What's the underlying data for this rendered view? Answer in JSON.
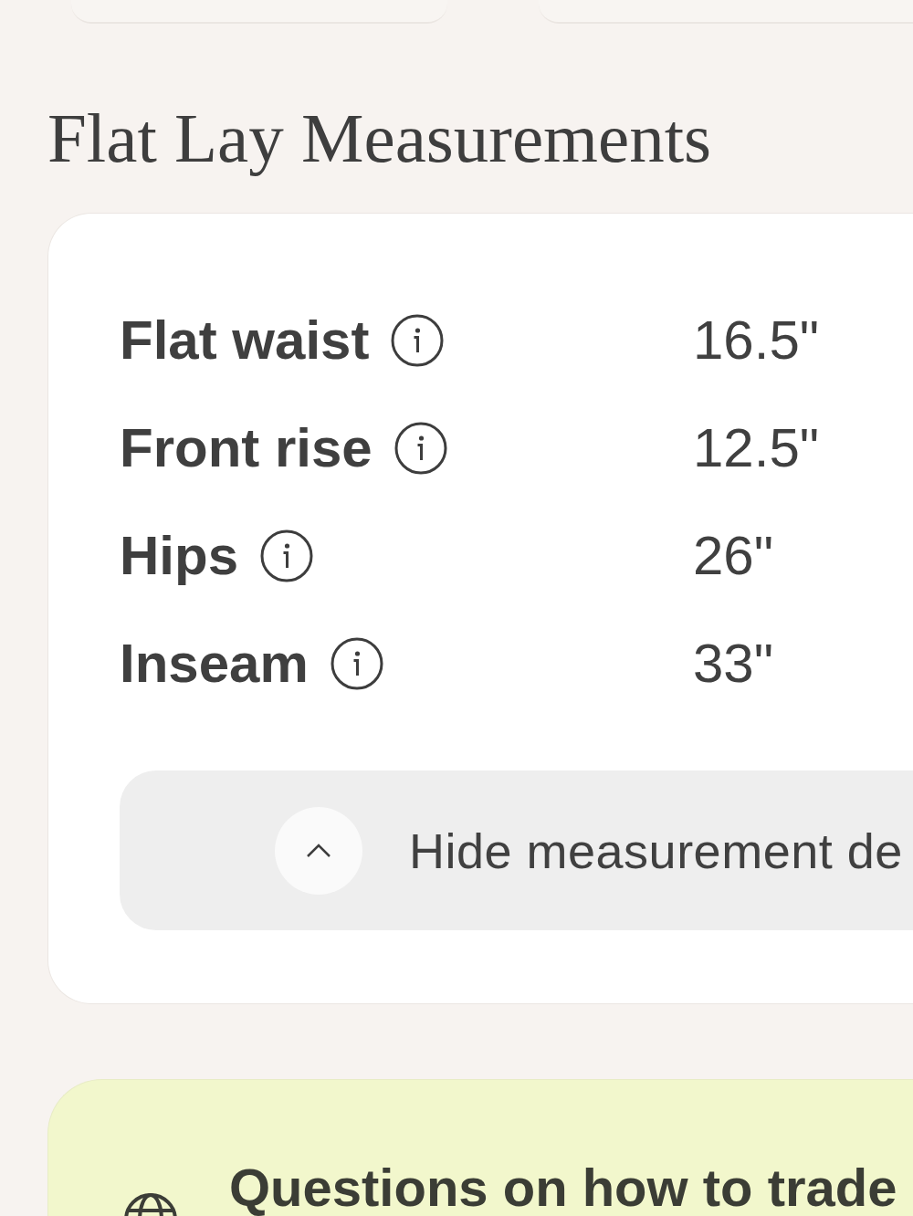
{
  "section_title": "Flat Lay Measurements",
  "measurements": [
    {
      "label": "Flat waist",
      "value": "16.5\""
    },
    {
      "label": "Front rise",
      "value": "12.5\""
    },
    {
      "label": "Hips",
      "value": "26\""
    },
    {
      "label": "Inseam",
      "value": "33\""
    }
  ],
  "toggle_button": {
    "label": "Hide measurement de",
    "expanded": true
  },
  "help_card": {
    "title": "Questions on how to trade"
  }
}
